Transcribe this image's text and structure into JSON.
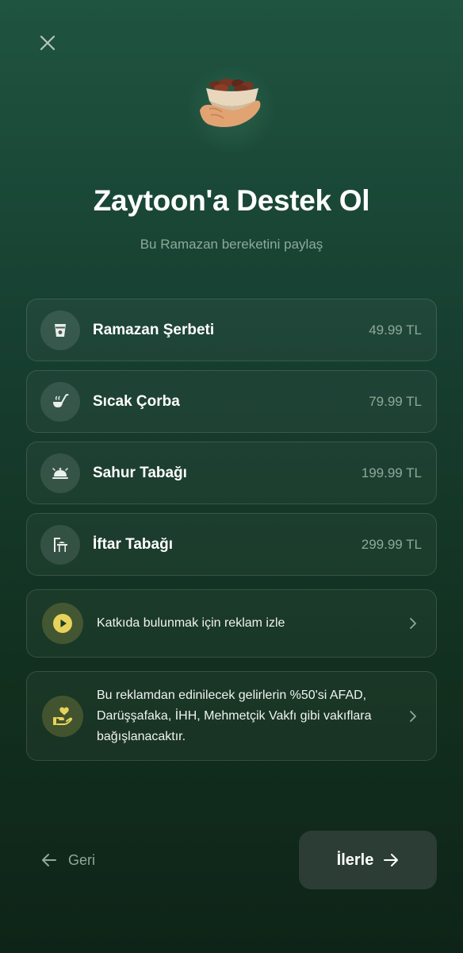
{
  "header": {
    "title": "Zaytoon'a Destek Ol",
    "subtitle": "Bu Ramazan bereketini paylaş"
  },
  "icons": {
    "close": "close-icon",
    "hero": "hand-holding-dates-bowl-icon"
  },
  "donations": [
    {
      "label": "Ramazan Şerbeti",
      "price": "49.99 TL",
      "icon": "drink-cup-icon"
    },
    {
      "label": "Sıcak Çorba",
      "price": "79.99 TL",
      "icon": "soup-ladle-icon"
    },
    {
      "label": "Sahur Tabağı",
      "price": "199.99 TL",
      "icon": "food-cloche-icon"
    },
    {
      "label": "İftar Tabağı",
      "price": "299.99 TL",
      "icon": "dinner-table-icon"
    }
  ],
  "ad": {
    "watch_label": "Katkıda bulunmak için reklam izle",
    "watch_icon": "play-circle-icon",
    "info_text": "Bu reklamdan edinilecek gelirlerin %50'si AFAD, Darüşşafaka, İHH, Mehmetçik Vakfı gibi vakıflara bağışlanacaktır.",
    "info_icon": "hand-heart-icon"
  },
  "footer": {
    "back_label": "Geri",
    "next_label": "İlerle"
  },
  "colors": {
    "accent_yellow": "#e8d35a",
    "muted_text": "#8ea99a",
    "background": "#173f31"
  }
}
